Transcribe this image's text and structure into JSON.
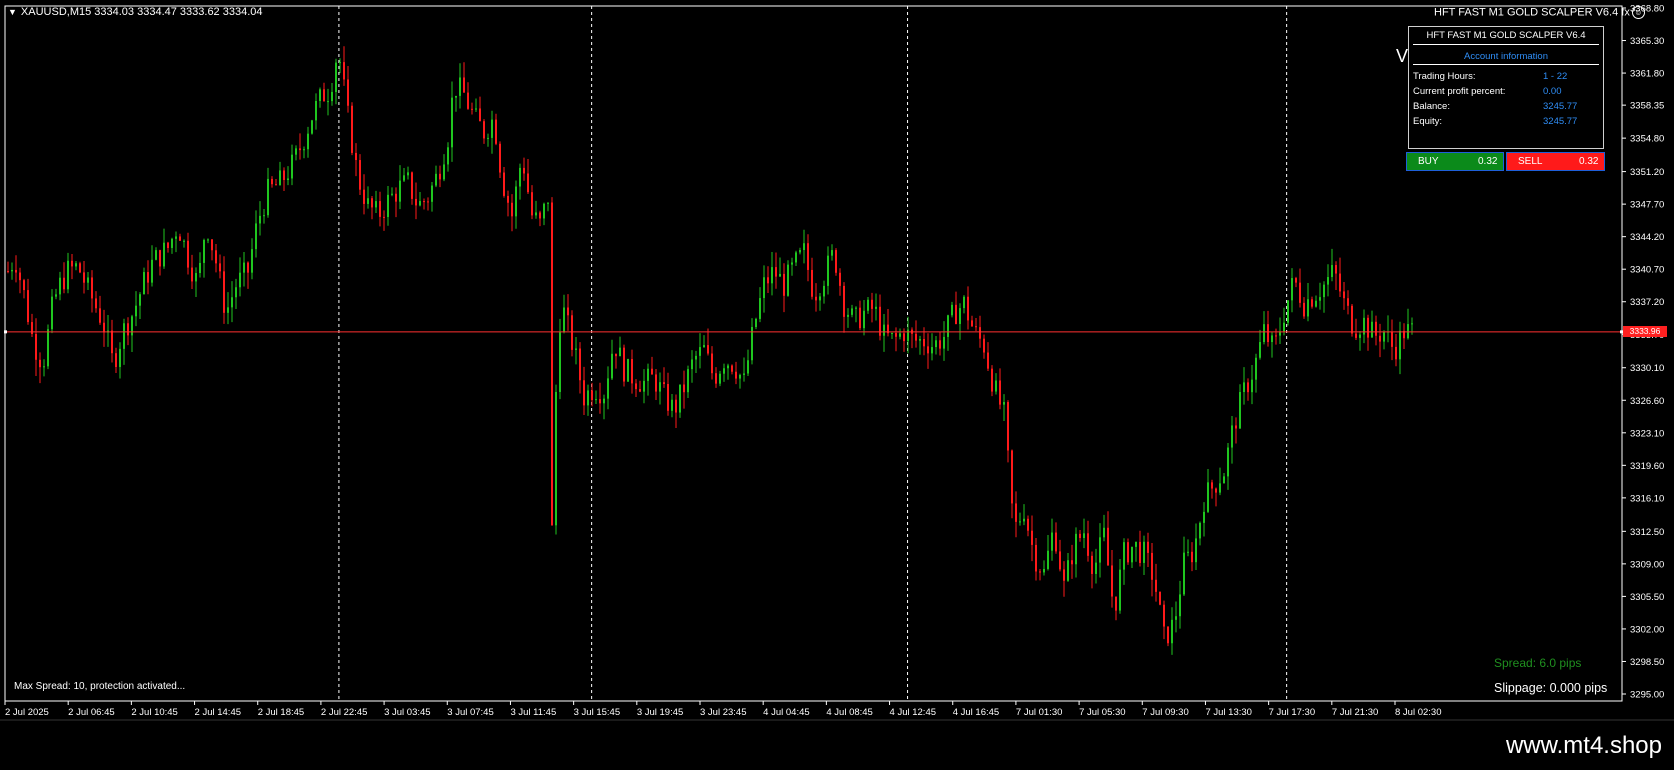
{
  "header": {
    "symbol_info": "XAUUSD,M15  3334.03 3334.47 3333.62 3334.04",
    "ea_title": "HFT FAST M1 GOLD SCALPER V6.4 fx"
  },
  "panel": {
    "title": "HFT FAST M1 GOLD SCALPER V6.4",
    "subtitle": "Account information",
    "rows": [
      {
        "label": "Trading Hours:",
        "value": "1 - 22"
      },
      {
        "label": "Current profit percent:",
        "value": "0.00"
      },
      {
        "label": "Balance:",
        "value": "3245.77"
      },
      {
        "label": "Equity:",
        "value": "3245.77"
      }
    ],
    "partial_char": "V"
  },
  "buttons": {
    "buy_label": "BUY",
    "buy_lot": "0.32",
    "sell_label": "SELL",
    "sell_lot": "0.32"
  },
  "status": {
    "spread_msg": "Max Spread: 10, protection activated...",
    "spread": "Spread: 6.0 pips",
    "slippage": "Slippage: 0.000 pips"
  },
  "watermark": "www.mt4.shop",
  "colors": {
    "bull": "#1fc61f",
    "bear": "#ff1a1a",
    "price_line": "#ff3030",
    "grid": "#ffffff",
    "axis": "#ffffff",
    "accent_blue": "#2f8df5"
  },
  "chart_data": {
    "type": "candlestick",
    "symbol": "XAUUSD",
    "timeframe": "M15",
    "current_price": 3333.96,
    "current_price_label": "3333.96",
    "ylim": [
      3295.0,
      3368.8
    ],
    "y_ticks": [
      "3368.80",
      "3365.30",
      "3361.80",
      "3358.35",
      "3354.80",
      "3351.20",
      "3347.70",
      "3344.20",
      "3340.70",
      "3337.20",
      "3333.70",
      "3330.10",
      "3326.60",
      "3323.10",
      "3319.60",
      "3316.10",
      "3312.50",
      "3309.00",
      "3305.50",
      "3302.00",
      "3298.50",
      "3295.00"
    ],
    "x_ticks": [
      "2 Jul 2025",
      "2 Jul 06:45",
      "2 Jul 10:45",
      "2 Jul 14:45",
      "2 Jul 18:45",
      "2 Jul 22:45",
      "3 Jul 03:45",
      "3 Jul 07:45",
      "3 Jul 11:45",
      "3 Jul 15:45",
      "3 Jul 19:45",
      "3 Jul 23:45",
      "4 Jul 04:45",
      "4 Jul 08:45",
      "4 Jul 12:45",
      "4 Jul 16:45",
      "7 Jul 01:30",
      "7 Jul 05:30",
      "7 Jul 09:30",
      "7 Jul 13:30",
      "7 Jul 17:30",
      "7 Jul 21:30",
      "8 Jul 02:30"
    ],
    "day_separators_after_tick": [
      5,
      9,
      14,
      20
    ],
    "close_path": [
      [
        0,
        3340.5
      ],
      [
        7,
        3342
      ],
      [
        16,
        3338
      ],
      [
        25,
        3333
      ],
      [
        35,
        3330.5
      ],
      [
        45,
        3337
      ],
      [
        52,
        3339
      ],
      [
        60,
        3340.5
      ],
      [
        70,
        3341
      ],
      [
        80,
        3338.5
      ],
      [
        95,
        3335
      ],
      [
        105,
        3330.5
      ],
      [
        115,
        3334
      ],
      [
        125,
        3336
      ],
      [
        135,
        3339
      ],
      [
        145,
        3341.5
      ],
      [
        160,
        3343
      ],
      [
        170,
        3345.5
      ],
      [
        180,
        3342
      ],
      [
        190,
        3339
      ],
      [
        198,
        3346
      ],
      [
        208,
        3341.5
      ],
      [
        218,
        3336
      ],
      [
        228,
        3339
      ],
      [
        240,
        3340.5
      ],
      [
        250,
        3346
      ],
      [
        260,
        3349
      ],
      [
        272,
        3350
      ],
      [
        285,
        3352
      ],
      [
        295,
        3354.5
      ],
      [
        305,
        3357.5
      ],
      [
        315,
        3359.5
      ],
      [
        322,
        3360
      ],
      [
        330,
        3364.5
      ],
      [
        340,
        3357
      ],
      [
        350,
        3350.5
      ],
      [
        360,
        3347.5
      ],
      [
        370,
        3346.5
      ],
      [
        380,
        3348
      ],
      [
        392,
        3349.5
      ],
      [
        400,
        3350
      ],
      [
        410,
        3347.5
      ],
      [
        420,
        3348.5
      ],
      [
        430,
        3351
      ],
      [
        440,
        3355
      ],
      [
        446,
        3360.5
      ],
      [
        456,
        3359.5
      ],
      [
        466,
        3357
      ],
      [
        476,
        3355.5
      ],
      [
        486,
        3357
      ],
      [
        494,
        3350.5
      ],
      [
        504,
        3346.5
      ],
      [
        514,
        3353
      ],
      [
        524,
        3346.5
      ],
      [
        532,
        3345.5
      ],
      [
        540,
        3348.5
      ],
      [
        544,
        3312.5
      ],
      [
        550,
        3335
      ],
      [
        556,
        3336
      ],
      [
        566,
        3332
      ],
      [
        576,
        3327
      ],
      [
        586,
        3328
      ],
      [
        596,
        3327.5
      ],
      [
        606,
        3333
      ],
      [
        616,
        3330
      ],
      [
        626,
        3329
      ],
      [
        636,
        3328.5
      ],
      [
        646,
        3329
      ],
      [
        656,
        3327
      ],
      [
        666,
        3325.5
      ],
      [
        676,
        3328
      ],
      [
        686,
        3331
      ],
      [
        696,
        3332
      ],
      [
        706,
        3329
      ],
      [
        716,
        3331
      ],
      [
        726,
        3330.5
      ],
      [
        736,
        3328.5
      ],
      [
        746,
        3334.5
      ],
      [
        756,
        3339
      ],
      [
        766,
        3340.5
      ],
      [
        776,
        3339
      ],
      [
        786,
        3341
      ],
      [
        796,
        3342.5
      ],
      [
        806,
        3338
      ],
      [
        816,
        3340
      ],
      [
        826,
        3342.5
      ],
      [
        836,
        3337
      ],
      [
        846,
        3335
      ],
      [
        856,
        3336
      ],
      [
        866,
        3336.5
      ],
      [
        876,
        3333.5
      ],
      [
        886,
        3333
      ],
      [
        896,
        3334
      ],
      [
        906,
        3333
      ],
      [
        916,
        3333
      ],
      [
        926,
        3332.5
      ],
      [
        936,
        3333.5
      ],
      [
        946,
        3336
      ],
      [
        956,
        3337
      ],
      [
        966,
        3334
      ],
      [
        976,
        3332.5
      ],
      [
        986,
        3328
      ],
      [
        996,
        3325
      ],
      [
        1006,
        3312.5
      ],
      [
        1016,
        3315
      ],
      [
        1026,
        3310
      ],
      [
        1036,
        3308
      ],
      [
        1046,
        3313
      ],
      [
        1056,
        3306.5
      ],
      [
        1066,
        3311
      ],
      [
        1076,
        3312.5
      ],
      [
        1086,
        3308.5
      ],
      [
        1096,
        3312
      ],
      [
        1106,
        3304
      ],
      [
        1116,
        3310
      ],
      [
        1126,
        3311
      ],
      [
        1136,
        3310
      ],
      [
        1146,
        3307.5
      ],
      [
        1156,
        3301
      ],
      [
        1166,
        3302.5
      ],
      [
        1176,
        3309
      ],
      [
        1186,
        3310.5
      ],
      [
        1196,
        3316
      ],
      [
        1206,
        3317.5
      ],
      [
        1216,
        3319
      ],
      [
        1226,
        3324
      ],
      [
        1236,
        3327.5
      ],
      [
        1246,
        3330
      ],
      [
        1256,
        3334
      ],
      [
        1266,
        3332
      ],
      [
        1276,
        3336
      ],
      [
        1286,
        3339.5
      ],
      [
        1296,
        3337
      ],
      [
        1306,
        3338
      ],
      [
        1316,
        3339
      ],
      [
        1326,
        3340.5
      ],
      [
        1336,
        3337
      ],
      [
        1346,
        3334.5
      ],
      [
        1356,
        3335
      ],
      [
        1366,
        3333.5
      ],
      [
        1376,
        3334
      ],
      [
        1386,
        3332
      ],
      [
        1396,
        3334
      ],
      [
        1404,
        3334
      ]
    ],
    "candle_amplitude": 1.8,
    "candle_step": 4
  }
}
